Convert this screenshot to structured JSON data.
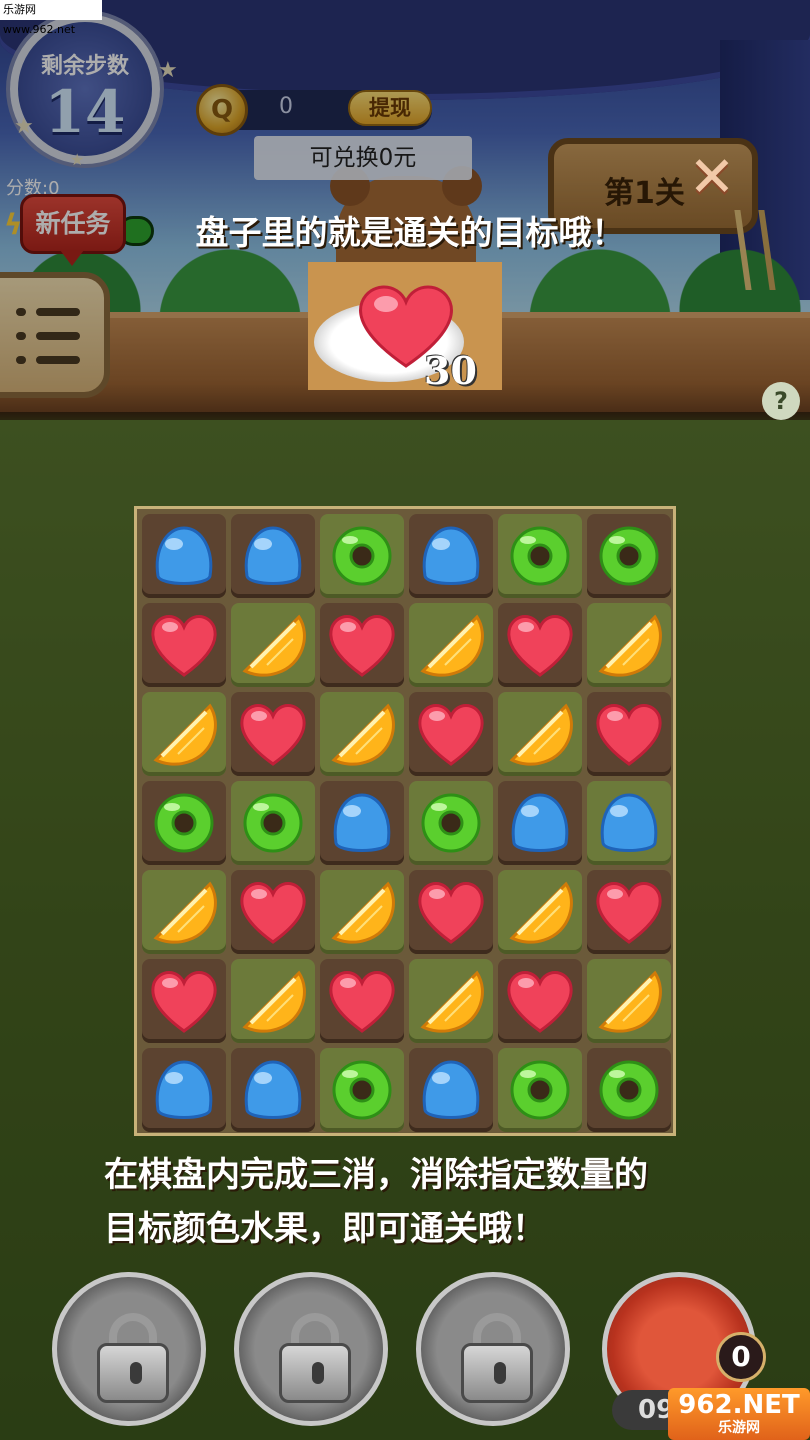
{
  "hud": {
    "steps_label": "剩余步数",
    "steps_value": "14",
    "coin_value": "0",
    "withdraw_label": "提现",
    "exchange_text": "可兑换0元",
    "score_label": "分数:0",
    "mission_label": "新任务",
    "level_label": "第1关"
  },
  "tutorial": {
    "title": "盘子里的就是通关的目标哦！",
    "goal_count": "30",
    "desc_line1": "在棋盘内完成三消，消除指定数量的",
    "desc_line2": "目标颜色水果，即可通关哦！"
  },
  "board": {
    "rows": [
      [
        "blue",
        "blue",
        "green",
        "blue",
        "green",
        "green"
      ],
      [
        "red",
        "orange",
        "red",
        "orange",
        "red",
        "orange"
      ],
      [
        "orange",
        "red",
        "orange",
        "red",
        "orange",
        "red"
      ],
      [
        "green",
        "green",
        "blue",
        "green",
        "blue",
        "blue"
      ],
      [
        "orange",
        "red",
        "orange",
        "red",
        "orange",
        "red"
      ],
      [
        "red",
        "orange",
        "red",
        "orange",
        "red",
        "orange"
      ],
      [
        "blue",
        "blue",
        "green",
        "blue",
        "green",
        "green"
      ]
    ],
    "pattern": [
      [
        "dark",
        "dark",
        "light",
        "dark",
        "light",
        "dark"
      ],
      [
        "dark",
        "light",
        "dark",
        "light",
        "dark",
        "light"
      ],
      [
        "light",
        "dark",
        "light",
        "dark",
        "light",
        "dark"
      ],
      [
        "dark",
        "light",
        "dark",
        "light",
        "dark",
        "light"
      ],
      [
        "light",
        "dark",
        "light",
        "dark",
        "light",
        "dark"
      ],
      [
        "dark",
        "light",
        "dark",
        "light",
        "dark",
        "light"
      ],
      [
        "dark",
        "dark",
        "light",
        "dark",
        "light",
        "dark"
      ]
    ]
  },
  "boosters": {
    "bag_count": "0",
    "timer": "09"
  },
  "watermark": {
    "top": "乐游网 www.962.net",
    "logo": "962.NET",
    "logo_sub": "乐游网"
  }
}
